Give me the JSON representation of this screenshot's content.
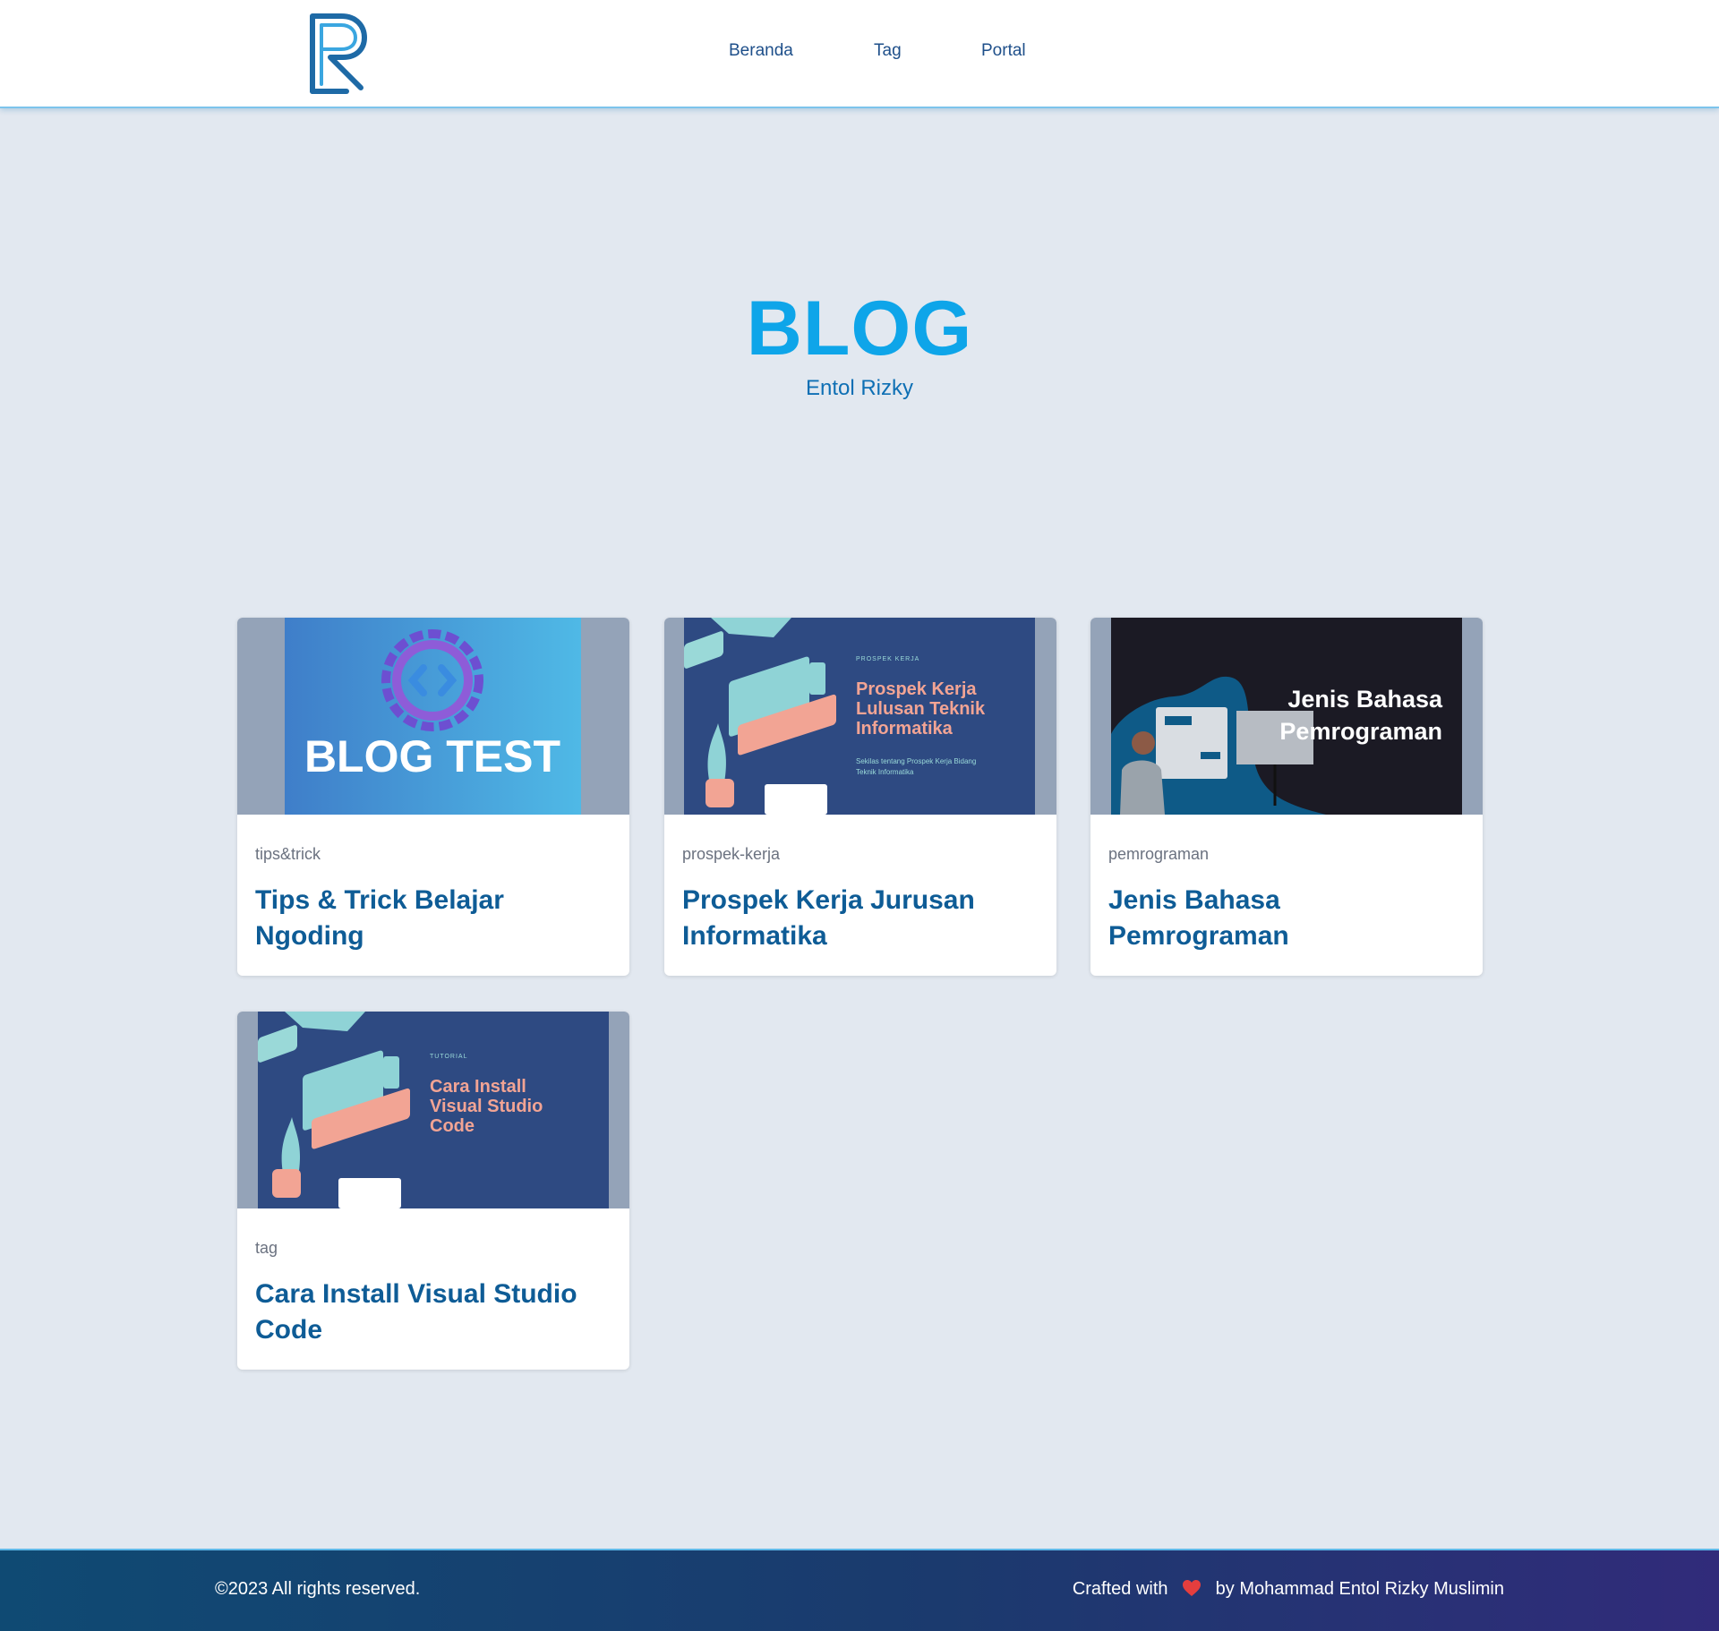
{
  "nav": {
    "logo_icon": "r-monogram-logo",
    "links": [
      {
        "label": "Beranda"
      },
      {
        "label": "Tag"
      },
      {
        "label": "Portal"
      }
    ]
  },
  "hero": {
    "title": "BLOG",
    "subtitle": "Entol Rizky"
  },
  "posts": [
    {
      "tag": "tips&trick",
      "title": "Tips & Trick Belajar Ngoding",
      "thumbnail": {
        "text": "BLOG TEST",
        "icon": "code-gear-icon"
      }
    },
    {
      "tag": "prospek-kerja",
      "title": "Prospek Kerja Jurusan Informatika",
      "thumbnail": {
        "kicker": "PROSPEK KERJA",
        "lines": [
          "Prospek Kerja",
          "Lulusan Teknik",
          "Informatika"
        ],
        "caption_lines": [
          "Sekilas tentang Prospek Kerja Bidang",
          "Teknik Informatika"
        ]
      }
    },
    {
      "tag": "pemrograman",
      "title": "Jenis Bahasa Pemrograman",
      "thumbnail": {
        "lines": [
          "Jenis Bahasa",
          "Pemrograman"
        ]
      }
    },
    {
      "tag": "tag",
      "title": "Cara Install Visual Studio Code",
      "thumbnail": {
        "kicker": "TUTORIAL",
        "lines": [
          "Cara Install",
          "Visual Studio",
          "Code"
        ]
      }
    }
  ],
  "footer": {
    "copyright": "©2023 All rights reserved.",
    "crafted_prefix": "Crafted with",
    "crafted_suffix": "by Mohammad Entol Rizky Muslimin",
    "heart_icon": "heart-icon"
  },
  "colors": {
    "accent": "#0ea5e9",
    "title_blue": "#0e5c96",
    "background": "#e2e8f0",
    "footer_start": "#0f4a73",
    "footer_end": "#312b7a"
  }
}
